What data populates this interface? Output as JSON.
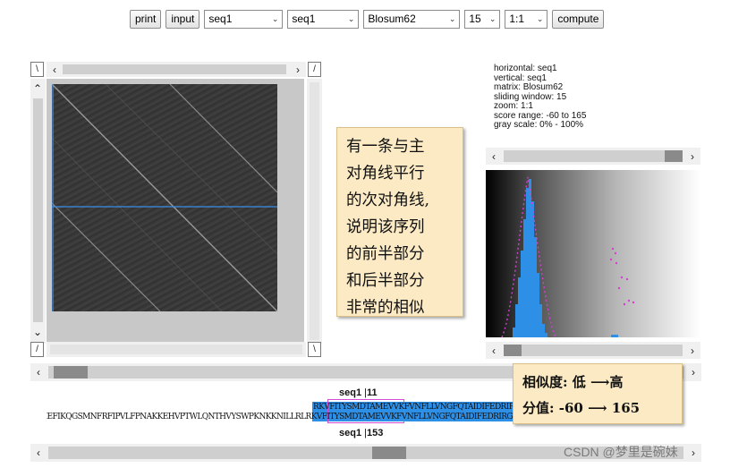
{
  "toolbar": {
    "print_label": "print",
    "input_label": "input",
    "horizontal_seq": "seq1",
    "vertical_seq": "seq1",
    "matrix": "Blosum62",
    "window": "15",
    "zoom": "1:1",
    "compute_label": "compute"
  },
  "info": {
    "horizontal": "horizontal: seq1",
    "vertical": "vertical: seq1",
    "matrix": "matrix: Blosum62",
    "sliding_window": "sliding window: 15",
    "zoom": "zoom: 1:1",
    "score_range": "score range: -60 to 165",
    "gray_scale": "gray scale: 0% - 100%"
  },
  "annotation_main": {
    "lines": [
      "有一条与主",
      "对角线平行",
      "的次对角线,",
      "说明该序列",
      "的前半部分",
      "和后半部分",
      "非常的相似"
    ]
  },
  "annotation_legend": {
    "line1": "相似度: 低 ⟶高",
    "line2": "分值: -60 ⟶ 165"
  },
  "alignment": {
    "top_label": "seq1",
    "top_pos": "11",
    "bottom_label": "seq1",
    "bottom_pos": "153",
    "top_seq": "RKVFITYSMDTAMEVVKFVNFLLVNGFQTAIDIFEDRIRG",
    "bottom_seq": "RMMQIEFIKQGSMNFRFIPVLFPNAKKEHVPTWLQNTHVYSWPKNKKNILLRLRKVFITYSMDTAMEVVKFVNFLLVNGFQTAIDIFEDRIRG"
  },
  "corners": {
    "left_small": "\\",
    "left_small2": "/",
    "bottom_left": "/",
    "bottom_right": "\\"
  },
  "icons": {
    "left": "‹",
    "right": "›",
    "up": "⌃",
    "down": "⌄",
    "dropdown": "⌄"
  },
  "colors": {
    "plot_bg": "#3a3a3a",
    "crosshair": "#3a8fe8",
    "histogram_bar": "#2e8fe6",
    "histogram_curve": "#d43fd4",
    "note_bg": "#fbeac4"
  },
  "watermark": "CSDN @梦里是碗妹"
}
